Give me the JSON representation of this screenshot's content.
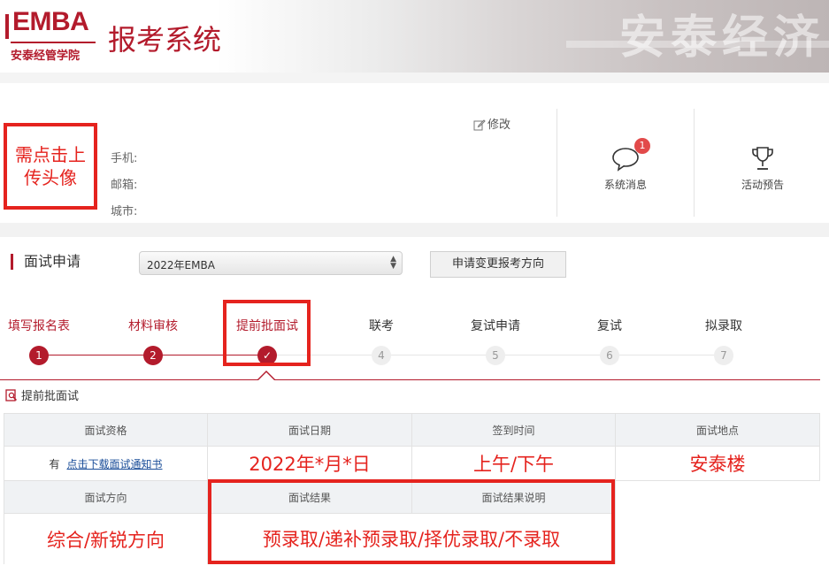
{
  "header": {
    "logo_main": "EMBA",
    "logo_school": "安泰经管学院",
    "system_title": "报考系统",
    "banner_text": "安泰经济"
  },
  "profile": {
    "avatar_hint": "需点击上传头像",
    "phone_label": "手机:",
    "email_label": "邮箱:",
    "city_label": "城市:",
    "edit_label": "修改"
  },
  "quick_links": {
    "messages_label": "系统消息",
    "messages_badge": "1",
    "events_label": "活动预告"
  },
  "application": {
    "section_title": "面试申请",
    "year_selected": "2022年EMBA",
    "change_button": "申请变更报考方向"
  },
  "steps": [
    {
      "label": "填写报名表",
      "num": "1",
      "state": "done"
    },
    {
      "label": "材料审核",
      "num": "2",
      "state": "done"
    },
    {
      "label": "提前批面试",
      "num": "✓",
      "state": "current"
    },
    {
      "label": "联考",
      "num": "4",
      "state": "todo"
    },
    {
      "label": "复试申请",
      "num": "5",
      "state": "todo"
    },
    {
      "label": "复试",
      "num": "6",
      "state": "todo"
    },
    {
      "label": "拟录取",
      "num": "7",
      "state": "todo"
    }
  ],
  "interview": {
    "subtitle": "提前批面试",
    "headers": [
      "面试资格",
      "面试日期",
      "签到时间",
      "面试地点"
    ],
    "eligibility": "有",
    "download_link": "点击下载面试通知书",
    "date": "2022年*月*日",
    "checkin_time": "上午/下午",
    "location": "安泰楼",
    "headers2": [
      "面试方向",
      "面试结果",
      "面试结果说明"
    ],
    "direction": "综合/新锐方向",
    "result": "预录取/递补预录取/择优录取/不录取"
  },
  "colors": {
    "brand": "#b31b2c",
    "annotation": "#e5231e"
  }
}
